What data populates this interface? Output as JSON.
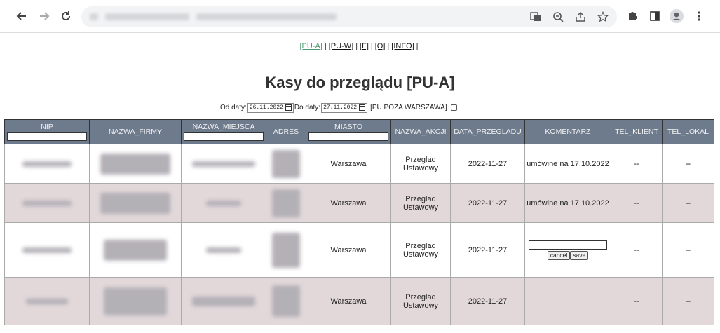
{
  "browser": {
    "icons": [
      "back-icon",
      "forward-icon",
      "reload-icon",
      "translate-icon",
      "zoom-icon",
      "share-icon",
      "star-icon",
      "extensions-icon",
      "sidepanel-icon",
      "profile-icon",
      "menu-icon"
    ]
  },
  "topnav": {
    "links": [
      {
        "label": "[PU-A]",
        "active": true
      },
      {
        "label": "[PU-W]",
        "active": false
      },
      {
        "label": "[F]",
        "active": false
      },
      {
        "label": "[O]",
        "active": false
      },
      {
        "label": "[INFO]",
        "active": false
      }
    ],
    "separator": "|"
  },
  "title": "Kasy do przeglądu [PU-A]",
  "datebar": {
    "from_label": "Od daty:",
    "from_value": "26.11.2022",
    "to_label": "Do daty:",
    "to_value": "27.11.2022",
    "checkbox_label": "[PU POZA WARSZAWA]"
  },
  "table": {
    "columns": [
      "NIP",
      "NAZWA_FIRMY",
      "NAZWA_MIEJSCA",
      "ADRES",
      "MIASTO",
      "NAZWA_AKCJI",
      "DATA_PRZEGLADU",
      "KOMENTARZ",
      "TEL_KLIENT",
      "TEL_LOKAL"
    ],
    "rows": [
      {
        "miasto": "Warszawa",
        "akcja": "Przeglad Ustawowy",
        "data": "2022-11-27",
        "komentarz": "umówine na 17.10.2022",
        "tel_klient": "--",
        "tel_lokal": "--"
      },
      {
        "miasto": "Warszawa",
        "akcja": "Przeglad Ustawowy",
        "data": "2022-11-27",
        "komentarz": "umówine na 17.10.2022",
        "tel_klient": "--",
        "tel_lokal": "--"
      },
      {
        "miasto": "Warszawa",
        "akcja": "Przeglad Ustawowy",
        "data": "2022-11-27",
        "komentarz": "",
        "editing": true,
        "tel_klient": "--",
        "tel_lokal": "--"
      },
      {
        "miasto": "Warszawa",
        "akcja": "Przeglad Ustawowy",
        "data": "2022-11-27",
        "komentarz": "",
        "tel_klient": "--",
        "tel_lokal": "--"
      }
    ],
    "edit_buttons": {
      "cancel": "cancel",
      "save": "save"
    }
  },
  "colors": {
    "header_bg": "#6d7b8d",
    "row_alt": "#e2d8da",
    "active_link": "#4c9a6f"
  }
}
